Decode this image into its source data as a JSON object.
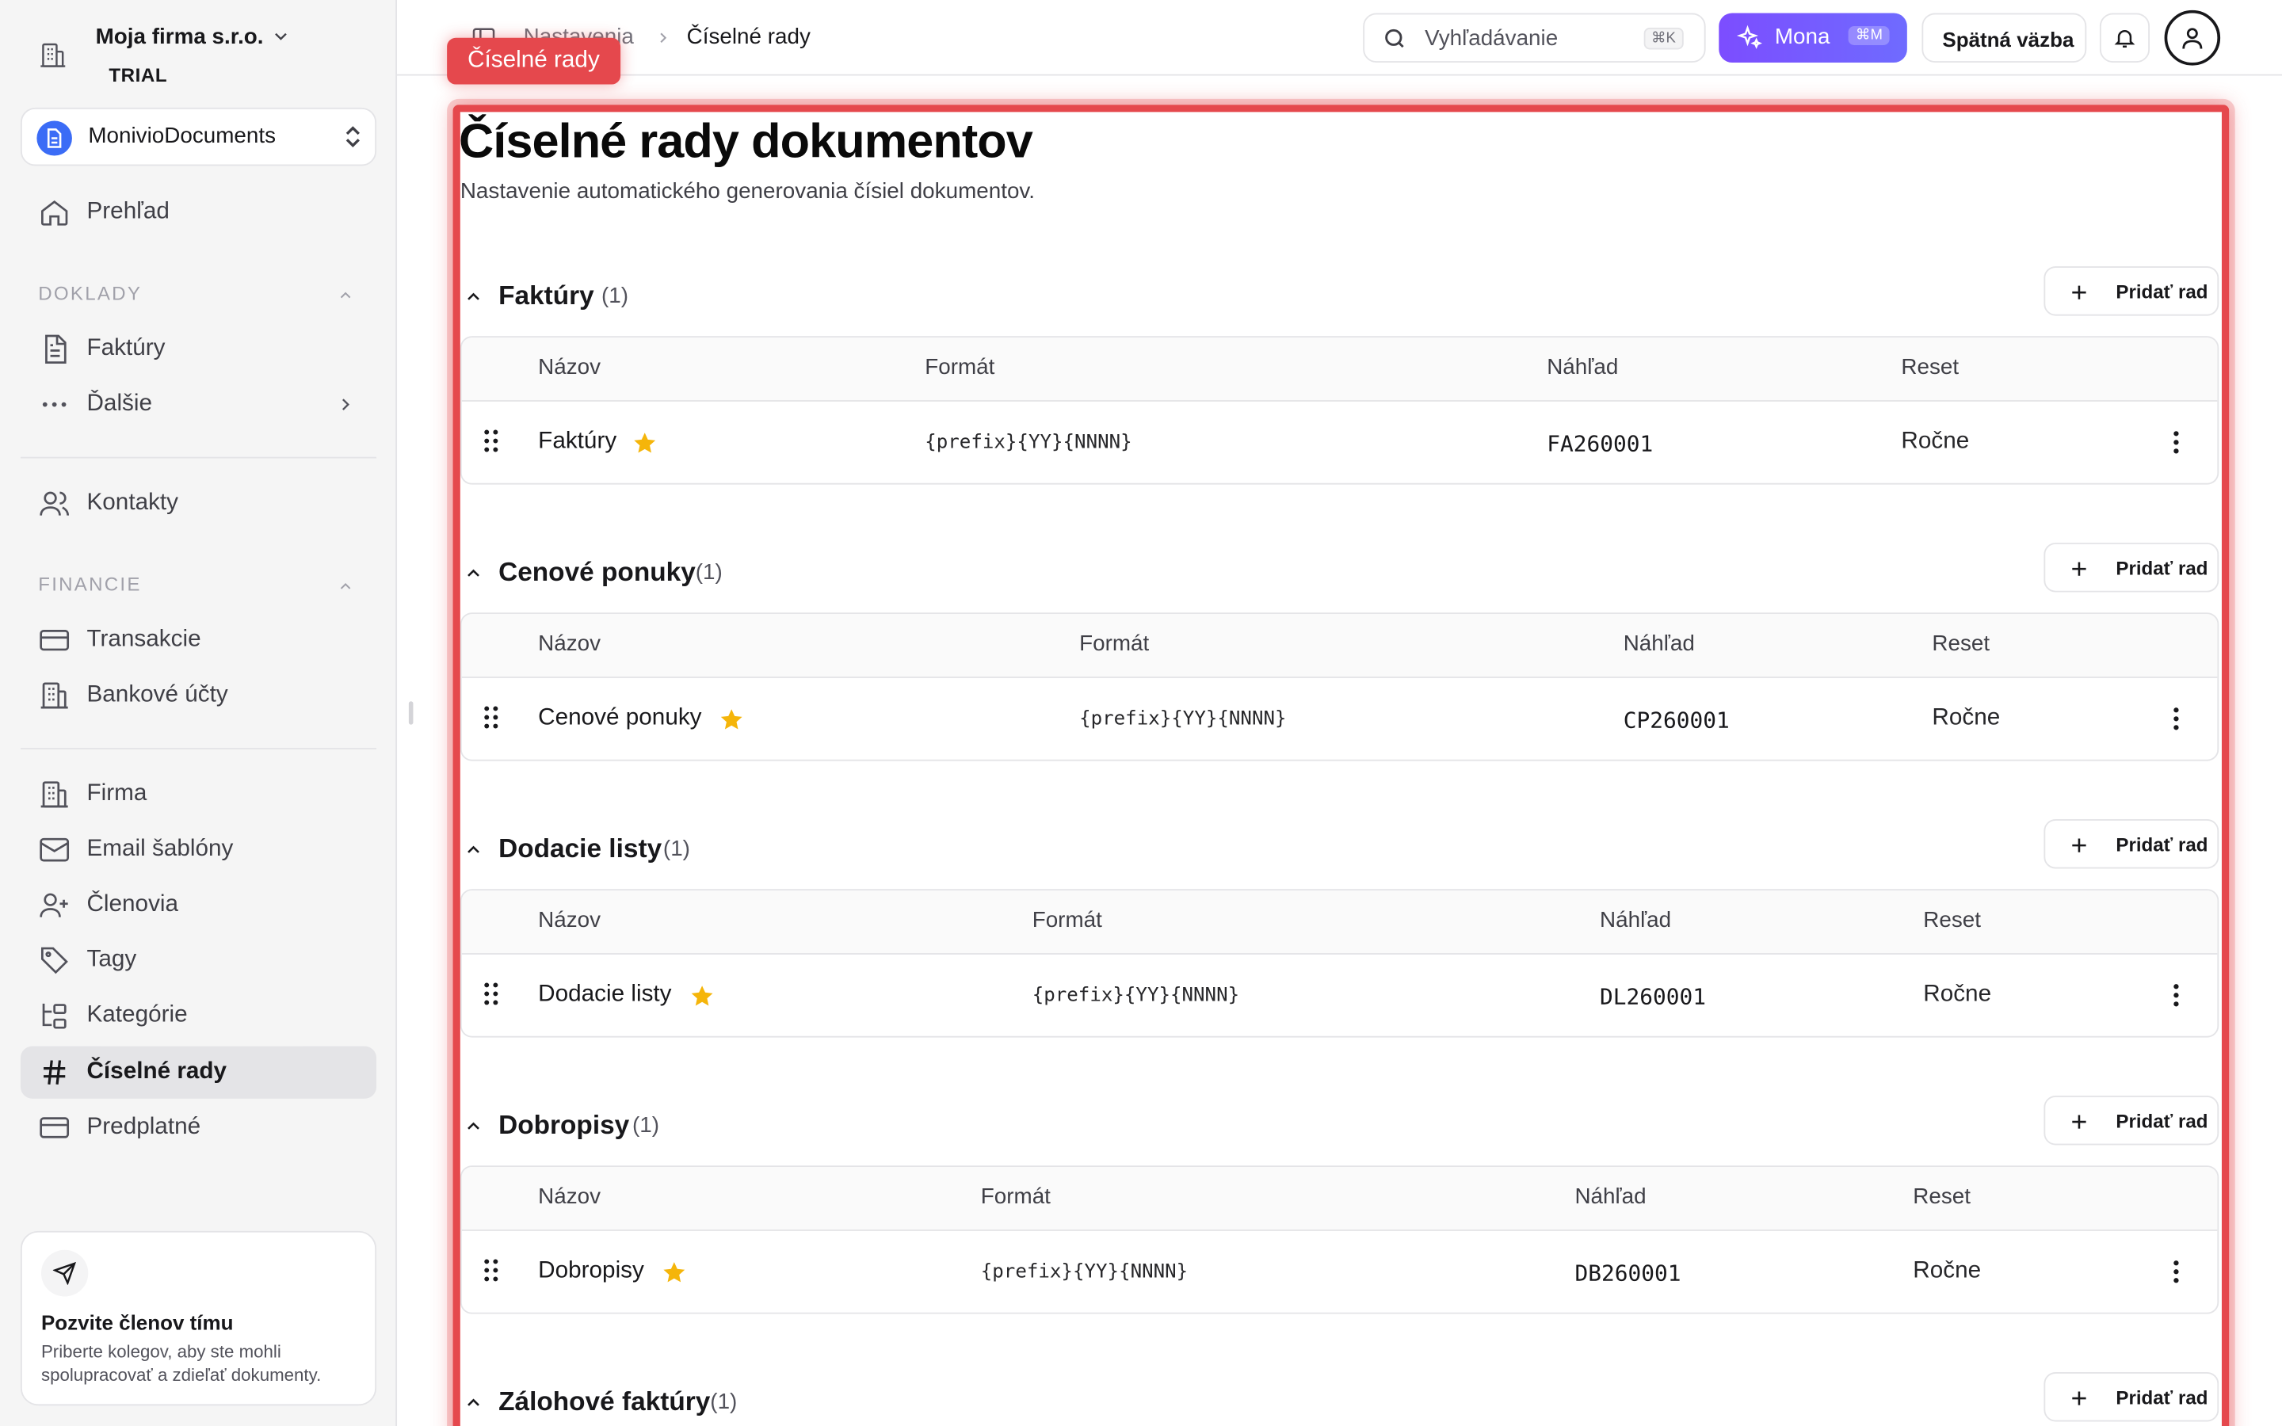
{
  "sidebar": {
    "company_name": "Moja firma s.r.o.",
    "plan": "TRIAL",
    "app_name": "MonivioDocuments",
    "overview": "Prehľad",
    "section_doklady": "DOKLADY",
    "faktury": "Faktúry",
    "dalsie": "Ďalšie",
    "kontakty": "Kontakty",
    "section_financie": "FINANCIE",
    "transakcie": "Transakcie",
    "bankove_ucty": "Bankové účty",
    "firma": "Firma",
    "email_sablony": "Email šablóny",
    "clenovia": "Členovia",
    "tagy": "Tagy",
    "kategorie": "Kategórie",
    "ciselne_rady": "Číselné rady",
    "predplatne": "Predplatné",
    "invite_title": "Pozvite členov tímu",
    "invite_desc": "Priberte kolegov, aby ste mohli spolupracovať a zdieľať dokumenty."
  },
  "topbar": {
    "breadcrumb_parent": "Nastavenia",
    "breadcrumb_current": "Číselné rady",
    "search_placeholder": "Vyhľadávanie",
    "search_shortcut": "⌘K",
    "mona_label": "Mona",
    "mona_shortcut": "⌘M",
    "feedback_label": "Spätná väzba"
  },
  "highlight_tag": "Číselné rady",
  "main": {
    "title": "Číselné rady dokumentov",
    "subtitle": "Nastavenie automatického generovania čísiel dokumentov.",
    "add_label": "Pridať rad",
    "col_name": "Názov",
    "col_format": "Formát",
    "col_preview": "Náhľad",
    "col_reset": "Reset",
    "groups": [
      {
        "name": "Faktúry",
        "count": "(1)",
        "row_name": "Faktúry",
        "format": "{prefix}{YY}{NNNN}",
        "preview": "FA260001",
        "reset": "Ročne"
      },
      {
        "name": "Cenové ponuky",
        "count": "(1)",
        "row_name": "Cenové ponuky",
        "format": "{prefix}{YY}{NNNN}",
        "preview": "CP260001",
        "reset": "Ročne"
      },
      {
        "name": "Dodacie listy",
        "count": "(1)",
        "row_name": "Dodacie listy",
        "format": "{prefix}{YY}{NNNN}",
        "preview": "DL260001",
        "reset": "Ročne"
      },
      {
        "name": "Dobropisy",
        "count": "(1)",
        "row_name": "Dobropisy",
        "format": "{prefix}{YY}{NNNN}",
        "preview": "DB260001",
        "reset": "Ročne"
      },
      {
        "name": "Zálohové faktúry",
        "count": "(1)"
      }
    ]
  },
  "colors": {
    "accent": "#7c4dff",
    "highlight": "#e5484d",
    "star": "#f5b50a",
    "logo": "#3b6cf6"
  }
}
